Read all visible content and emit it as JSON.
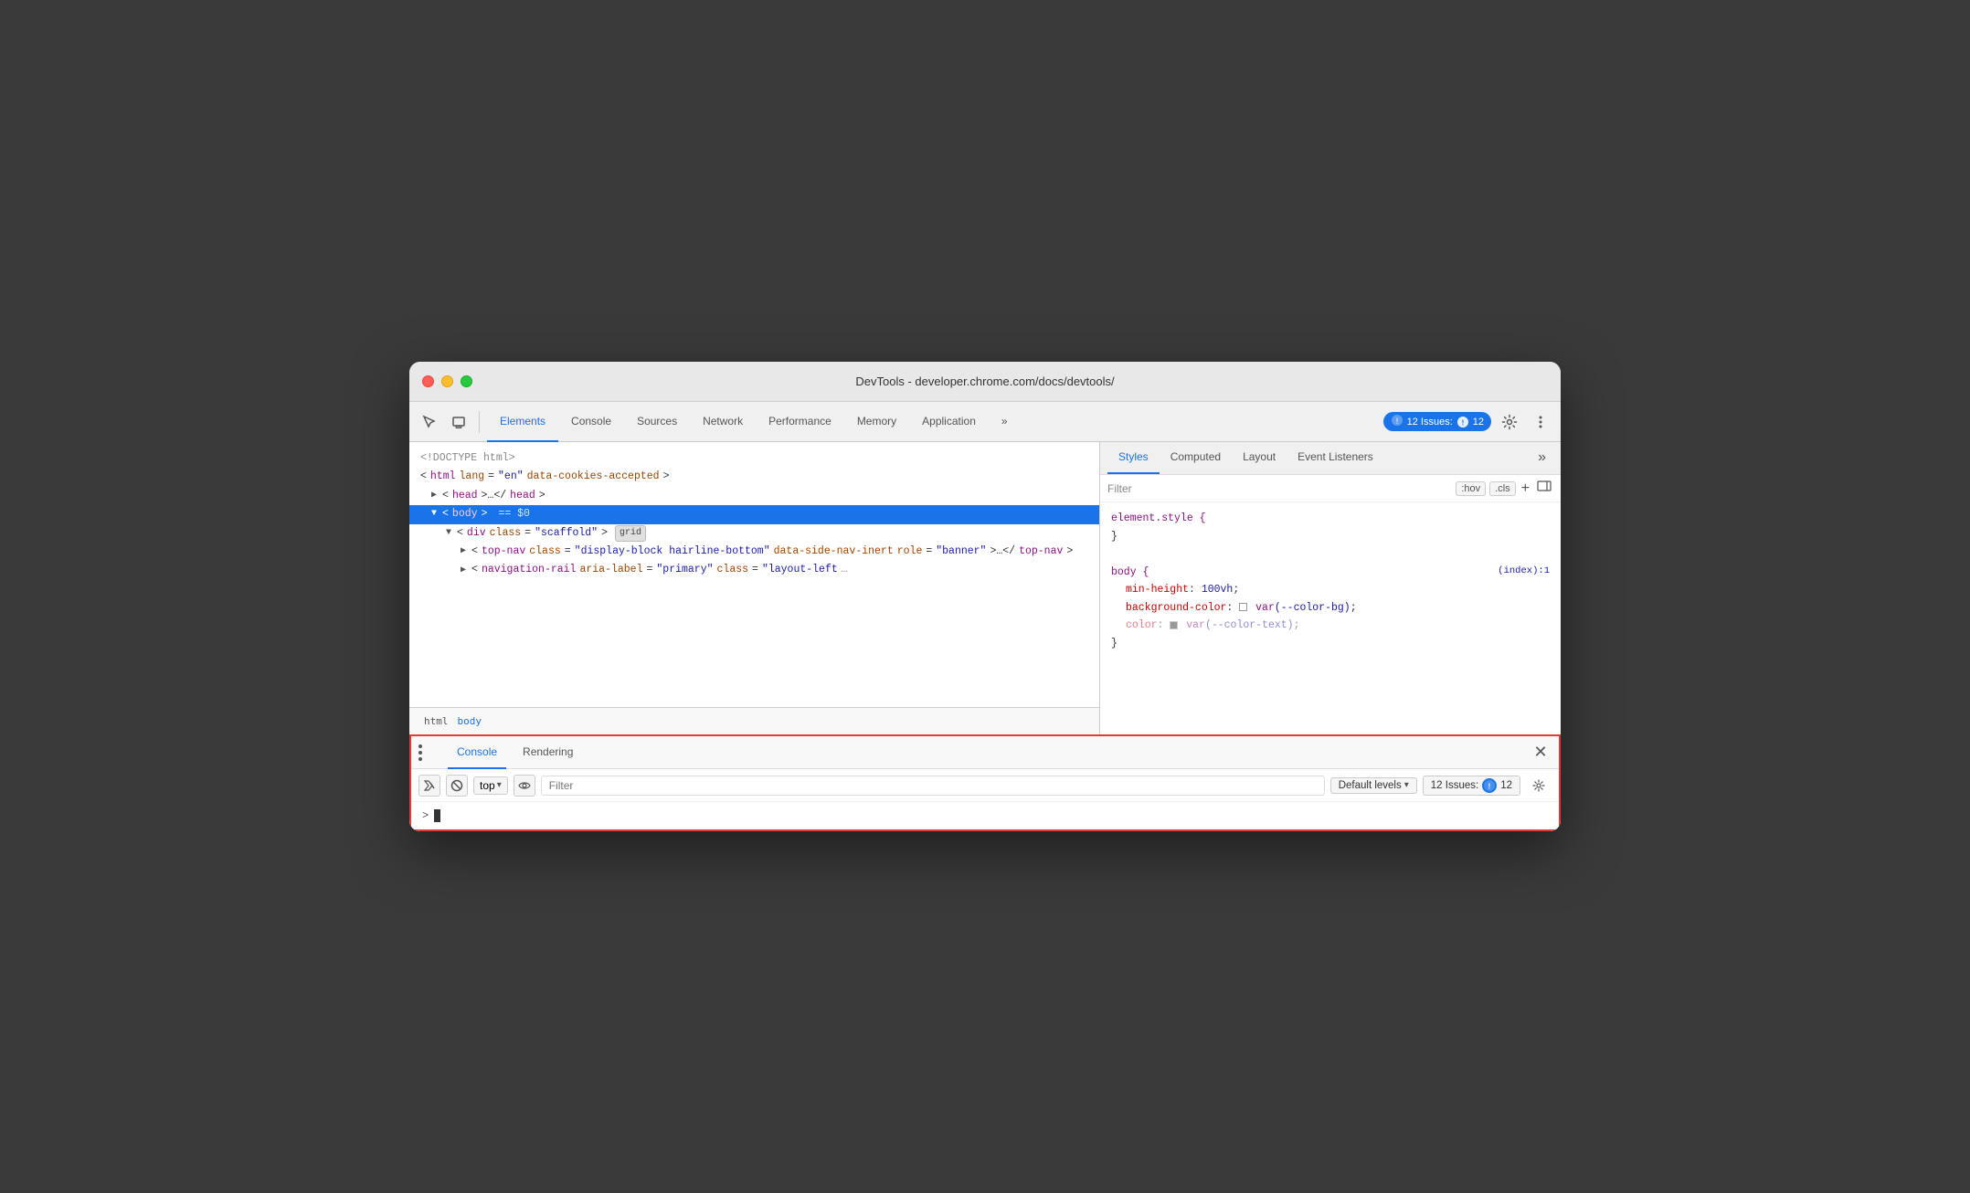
{
  "window": {
    "title": "DevTools - developer.chrome.com/docs/devtools/"
  },
  "tabs": {
    "items": [
      {
        "id": "elements",
        "label": "Elements",
        "active": true
      },
      {
        "id": "console",
        "label": "Console"
      },
      {
        "id": "sources",
        "label": "Sources"
      },
      {
        "id": "network",
        "label": "Network"
      },
      {
        "id": "performance",
        "label": "Performance"
      },
      {
        "id": "memory",
        "label": "Memory"
      },
      {
        "id": "application",
        "label": "Application"
      },
      {
        "id": "more",
        "label": "»"
      }
    ]
  },
  "toolbar": {
    "issues_count": "12",
    "issues_label": "12 Issues:",
    "settings_icon": "⚙",
    "more_icon": "⋮"
  },
  "elements_panel": {
    "lines": [
      {
        "text": "<!DOCTYPE html>",
        "indent": 0,
        "type": "doctype"
      },
      {
        "text": "",
        "indent": 0,
        "type": "html_open"
      },
      {
        "text": "",
        "indent": 0,
        "type": "head"
      },
      {
        "text": "",
        "indent": 0,
        "type": "body_selected"
      },
      {
        "text": "",
        "indent": 1,
        "type": "div_scaffold"
      },
      {
        "text": "",
        "indent": 2,
        "type": "top_nav"
      },
      {
        "text": "",
        "indent": 2,
        "type": "nav_rail"
      }
    ],
    "doctype": "<!DOCTYPE html>",
    "html_open": "<html lang=\"en\" data-cookies-accepted>",
    "head": "▶<head>…</head>",
    "body": "▼<body> == $0",
    "div_scaffold": "▼<div class=\"scaffold\">",
    "top_nav": "▶<top-nav class=\"display-block hairline-bottom\" data-side-nav-inert role=\"banner\">…</top-nav>",
    "nav_rail": "▶<navigation-rail aria-label=\"primary\" class=\"layout-left ?"
  },
  "breadcrumb": {
    "items": [
      "html",
      "body"
    ]
  },
  "styles_panel": {
    "tabs": [
      "Styles",
      "Computed",
      "Layout",
      "Event Listeners"
    ],
    "active_tab": "Styles",
    "filter_placeholder": "Filter",
    "hov_label": ":hov",
    "cls_label": ".cls",
    "rules": [
      {
        "selector": "element.style {",
        "closing": "}",
        "source": "",
        "properties": []
      },
      {
        "selector": "body {",
        "closing": "}",
        "source": "(index):1",
        "properties": [
          {
            "name": "min-height",
            "value": "100vh;"
          },
          {
            "name": "background-color",
            "value": "var(--color-bg);",
            "has_swatch": true,
            "swatch_color": "white"
          },
          {
            "name": "color",
            "value": "var(--color-text);",
            "has_swatch": true,
            "swatch_color": "dark",
            "faded": true
          }
        ]
      }
    ]
  },
  "drawer": {
    "tabs": [
      {
        "id": "console",
        "label": "Console",
        "active": true
      },
      {
        "id": "rendering",
        "label": "Rendering"
      }
    ],
    "console": {
      "filter_placeholder": "Filter",
      "top_selector": "top",
      "default_levels": "Default levels",
      "issues_count": "12",
      "issues_label": "12 Issues:"
    }
  }
}
